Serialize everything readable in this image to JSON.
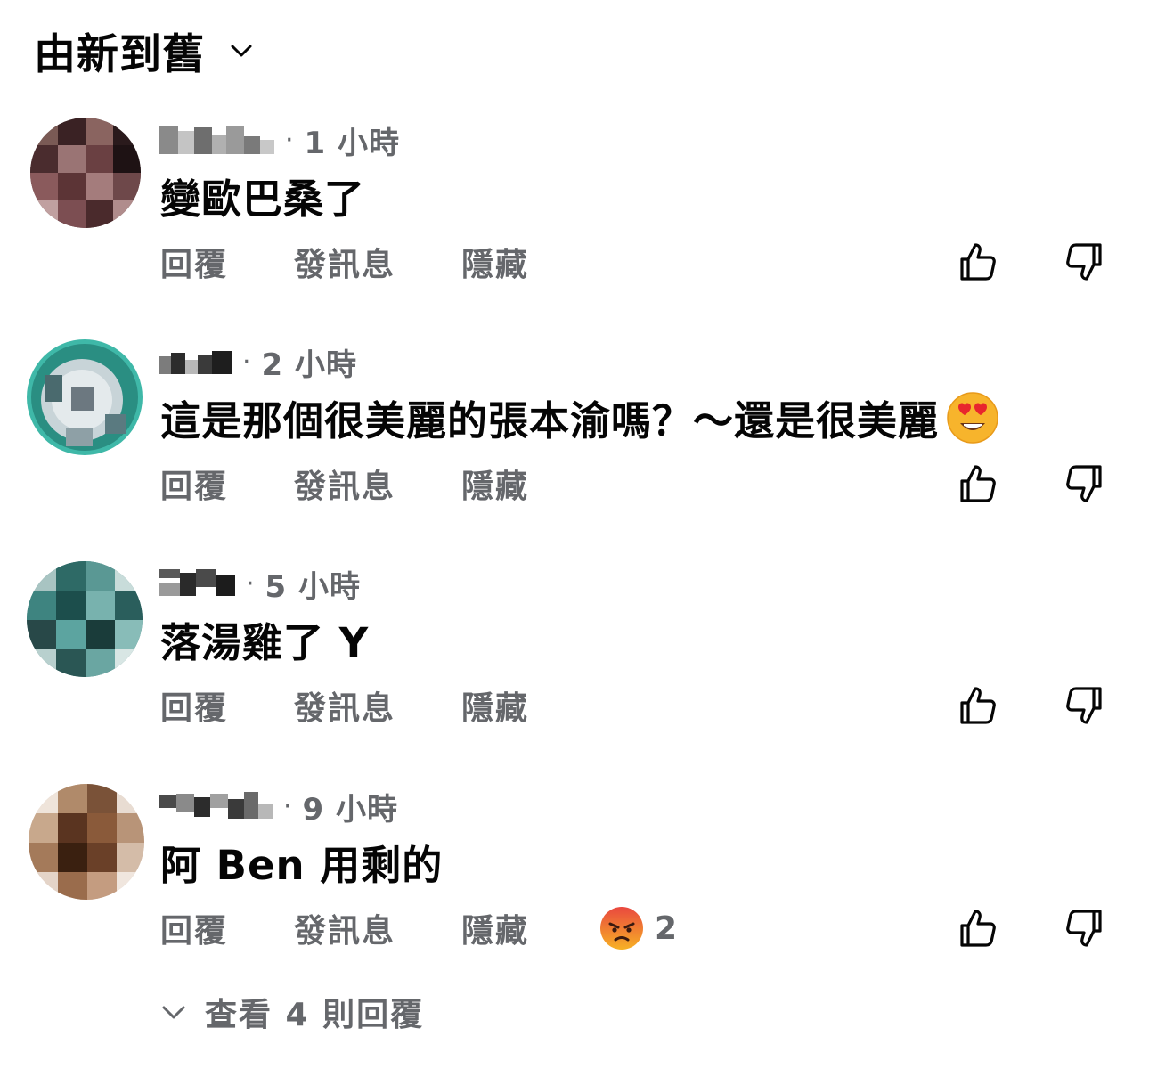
{
  "sort": {
    "label": "由新到舊",
    "icon": "chevron-down-icon"
  },
  "comments": [
    {
      "time": "1 小時",
      "text": "變歐巴桑了",
      "actions": {
        "reply": "回覆",
        "message": "發訊息",
        "hide": "隱藏"
      }
    },
    {
      "time": "2 小時",
      "text": "這是那個很美麗的張本渝嗎？～還是很美麗",
      "emoji": "heart-eyes-emoji",
      "actions": {
        "reply": "回覆",
        "message": "發訊息",
        "hide": "隱藏"
      }
    },
    {
      "time": "5 小時",
      "text": "落湯雞了 Y",
      "actions": {
        "reply": "回覆",
        "message": "發訊息",
        "hide": "隱藏"
      }
    },
    {
      "time": "9 小時",
      "text": "阿 Ben 用剩的",
      "actions": {
        "reply": "回覆",
        "message": "發訊息",
        "hide": "隱藏"
      },
      "reaction": {
        "icon": "angry-emoji",
        "count": "2"
      }
    }
  ],
  "view_replies": {
    "label": "查看 4 則回覆",
    "icon": "chevron-down-icon"
  },
  "colors": {
    "text_primary": "#050505",
    "text_secondary": "#65676b"
  }
}
